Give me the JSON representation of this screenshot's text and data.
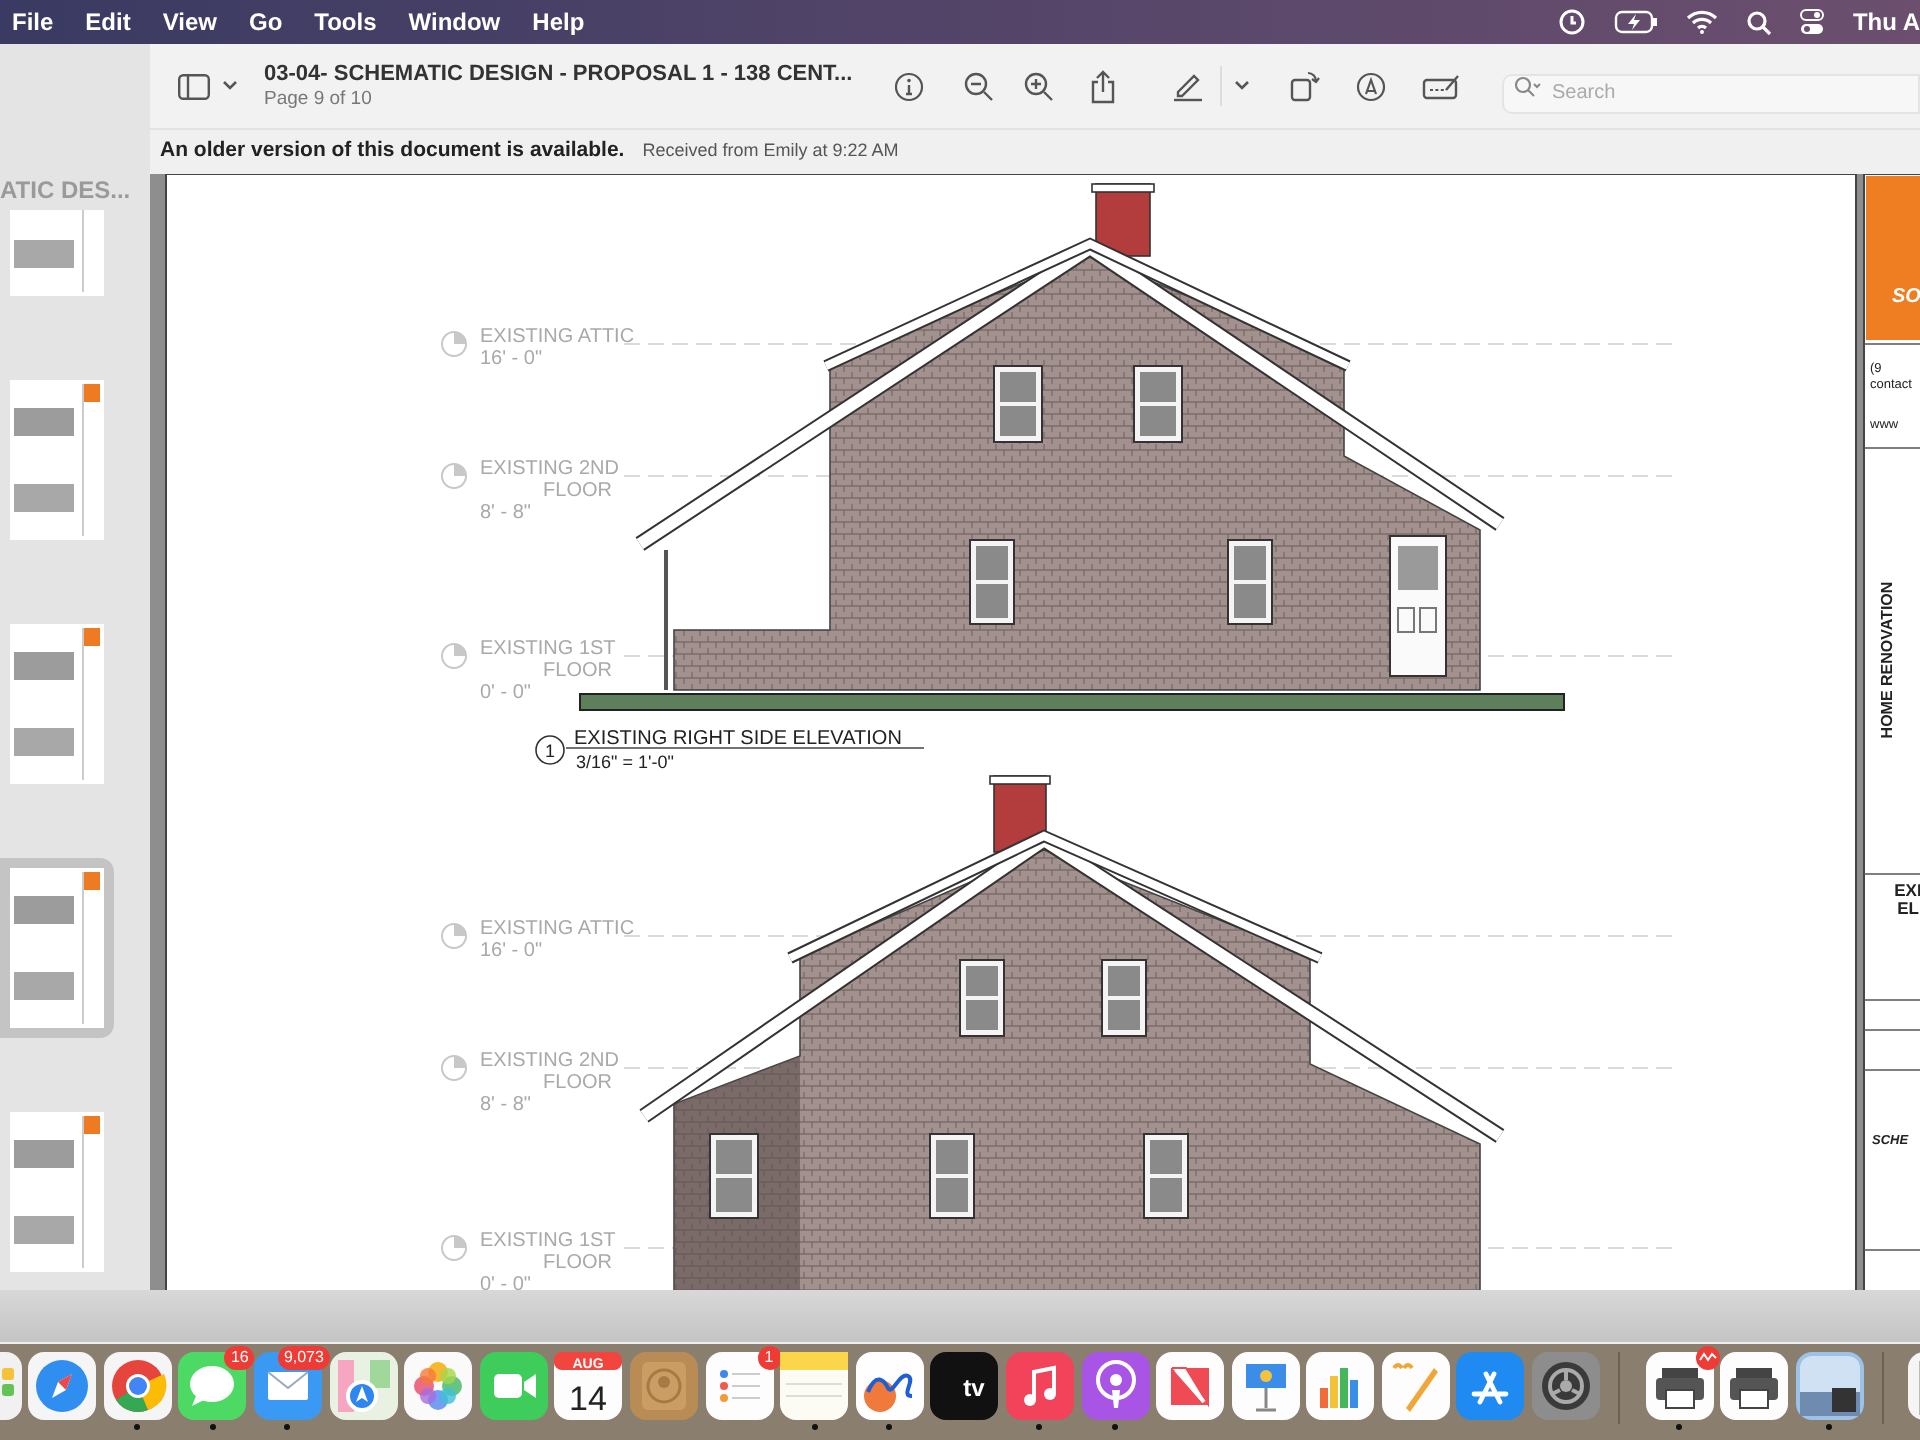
{
  "menu_bar": {
    "menus": [
      "File",
      "Edit",
      "View",
      "Go",
      "Tools",
      "Window",
      "Help"
    ],
    "clock": "Thu A"
  },
  "window": {
    "title": "03-04- SCHEMATIC DESIGN - PROPOSAL 1 - 138 CENT...",
    "subtitle": "Page 9 of 10",
    "search": {
      "placeholder": "Search"
    }
  },
  "notice": {
    "message": "An older version of this document is available.",
    "detail": "Received from Emily at 9:22 AM"
  },
  "sidebar": {
    "caption": "ATIC DES...",
    "thumbnails": [
      {
        "selected": false
      },
      {
        "selected": false
      },
      {
        "selected": false
      },
      {
        "selected": true
      },
      {
        "selected": false
      }
    ]
  },
  "document": {
    "elevations": [
      {
        "number": "1",
        "title": "EXISTING RIGHT SIDE ELEVATION",
        "scale": "3/16\" = 1'-0\"",
        "levels": [
          {
            "name_lines": [
              "EXISTING ATTIC"
            ],
            "height": "16' - 0\""
          },
          {
            "name_lines": [
              "EXISTING 2ND",
              "FLOOR"
            ],
            "height": "8' - 8\""
          },
          {
            "name_lines": [
              "EXISTING 1ST",
              "FLOOR"
            ],
            "height": "0' - 0\""
          }
        ]
      },
      {
        "levels": [
          {
            "name_lines": [
              "EXISTING ATTIC"
            ],
            "height": "16' - 0\""
          },
          {
            "name_lines": [
              "EXISTING 2ND",
              "FLOOR"
            ],
            "height": "8' - 8\""
          },
          {
            "name_lines": [
              "EXISTING 1ST",
              "FLOOR"
            ],
            "height": "0' - 0\""
          }
        ]
      }
    ],
    "title_block": {
      "firm": "SO",
      "contact_lines": [
        "(9",
        "contact",
        "www"
      ],
      "project": "HOME RENOVATION",
      "sheet_lines": [
        "EXI",
        "EL"
      ],
      "phase": "SCHE"
    }
  },
  "dock": {
    "sections": [
      [
        {
          "kind": "grid",
          "running": false
        },
        {
          "kind": "compass",
          "running": false
        },
        {
          "kind": "browser",
          "running": true
        },
        {
          "kind": "chat",
          "running": true,
          "badge": "16"
        },
        {
          "kind": "envelope",
          "running": true,
          "badge": "9,073"
        },
        {
          "kind": "map",
          "running": false
        },
        {
          "kind": "flower",
          "running": false
        },
        {
          "kind": "video",
          "running": false
        },
        {
          "kind": "calendar",
          "running": false,
          "month": "AUG",
          "day": "14"
        },
        {
          "kind": "contact",
          "running": false
        },
        {
          "kind": "checklist",
          "running": false,
          "badge": "1"
        },
        {
          "kind": "notepad",
          "running": true
        },
        {
          "kind": "scribble",
          "running": true
        },
        {
          "kind": "tv",
          "running": false,
          "label": "tv"
        },
        {
          "kind": "music",
          "running": true
        },
        {
          "kind": "podcast",
          "running": true
        },
        {
          "kind": "news",
          "running": false
        },
        {
          "kind": "lectern",
          "running": false
        },
        {
          "kind": "barchart",
          "running": false
        },
        {
          "kind": "pen",
          "running": false
        },
        {
          "kind": "appstore",
          "running": false
        },
        {
          "kind": "gear",
          "running": false
        }
      ],
      [
        {
          "kind": "printer",
          "running": true,
          "alert": true
        },
        {
          "kind": "printer",
          "running": false
        },
        {
          "kind": "photo",
          "running": true
        }
      ],
      [
        {
          "kind": "document",
          "running": false
        }
      ]
    ]
  }
}
